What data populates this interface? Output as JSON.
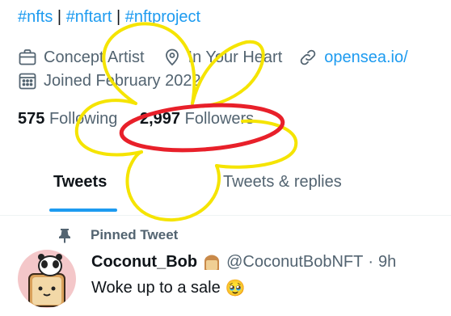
{
  "bio": {
    "hashtags": [
      "#nfts",
      "#nftart",
      "#nftproject"
    ],
    "separator": "|"
  },
  "profile_meta": {
    "profession": "Concept Artist",
    "location": "In Your Heart",
    "website": "opensea.io/",
    "joined": "Joined February 2022",
    "icons": [
      "briefcase-icon",
      "location-pin-icon",
      "link-icon",
      "calendar-icon"
    ]
  },
  "counts": {
    "following_value": "575",
    "following_label": "Following",
    "followers_value": "2,997",
    "followers_label": "Followers"
  },
  "tabs": [
    {
      "label": "Tweets",
      "active": true
    },
    {
      "label": "Tweets & replies",
      "active": false
    }
  ],
  "pinned_tweet": {
    "pinned_label": "Pinned Tweet",
    "author_name": "Coconut_Bob",
    "author_handle": "@CoconutBobNFT",
    "dot": "·",
    "time": "9h",
    "text": "Woke up to a sale",
    "emoji": "🥹"
  },
  "colors": {
    "accent": "#1d9bf0",
    "secondary_text": "#536471",
    "doodle_yellow": "#f5e400",
    "doodle_red": "#e8202a"
  }
}
